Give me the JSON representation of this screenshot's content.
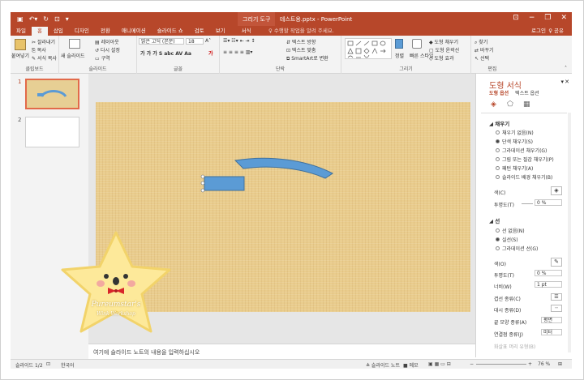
{
  "titlebar": {
    "context_tool": "그리기 도구",
    "doc_title": "테스트용.pptx - PowerPoint"
  },
  "tabs": [
    {
      "label": "파일"
    },
    {
      "label": "홈",
      "active": true
    },
    {
      "label": "삽입"
    },
    {
      "label": "디자인"
    },
    {
      "label": "전환"
    },
    {
      "label": "애니메이션"
    },
    {
      "label": "슬라이드 쇼"
    },
    {
      "label": "검토"
    },
    {
      "label": "보기"
    },
    {
      "label": "서식"
    }
  ],
  "tellme": "♀ 수행할 작업을 알려 주세요.",
  "login": "로그인",
  "share": "♀ 공유",
  "ribbon": {
    "clipboard": {
      "paste": "붙여넣기",
      "cut": "잘라내기",
      "copy": "복사",
      "format_painter": "서식 복사",
      "label": "클립보드"
    },
    "slides": {
      "new_slide": "새 슬라이드",
      "layout": "레이아웃",
      "reset": "다시 설정",
      "section": "구역",
      "label": "슬라이드"
    },
    "font": {
      "name": "맑은 고딕 (본문)",
      "size": "18",
      "label": "글꼴"
    },
    "paragraph": {
      "text_direction": "텍스트 방향",
      "align_text": "텍스트 맞춤",
      "smartart": "SmartArt로 변환",
      "label": "단락"
    },
    "drawing": {
      "arrange": "정렬",
      "quick_styles": "빠른 스타일",
      "fill": "도형 채우기",
      "outline": "도형 윤곽선",
      "effects": "도형 효과",
      "label": "그리기"
    },
    "editing": {
      "find": "찾기",
      "replace": "바꾸기",
      "select": "선택",
      "label": "편집"
    }
  },
  "slides_panel": [
    {
      "num": "1"
    },
    {
      "num": "2"
    }
  ],
  "notes_placeholder": "여기에 슬라이드 노트의 내용을 입력하십시오",
  "format_pane": {
    "title": "도형 서식",
    "tab_shape": "도형 옵션",
    "tab_text": "텍스트 옵션",
    "fill_header": "채우기",
    "fill_options": [
      "채우기 없음(N)",
      "단색 채우기(S)",
      "그라데이션 채우기(G)",
      "그림 또는 질감 채우기(P)",
      "패턴 채우기(A)",
      "슬라이드 배경 채우기(B)"
    ],
    "color_label": "색(C)",
    "transparency_label": "투명도(T)",
    "transparency_value": "0 %",
    "line_header": "선",
    "line_options": [
      "선 없음(N)",
      "실선(S)",
      "그라데이션 선(G)"
    ],
    "line_color_label": "색(O)",
    "line_transparency_label": "투명도(T)",
    "line_transparency_value": "0 %",
    "width_label": "너비(W)",
    "width_value": "1 pt",
    "compound_label": "겹선 종류(C)",
    "dash_label": "대시 종류(D)",
    "cap_label": "끝 모양 종류(A)",
    "cap_value": "평면",
    "join_label": "연결점 종류(J)",
    "join_value": "미터",
    "arrow_label": "화살표 머리 유형(B)"
  },
  "status": {
    "slide_info": "슬라이드 1/2",
    "language": "한국어",
    "notes": "≜ 슬라이드 노트",
    "comments": "■ 메모",
    "zoom": "76 %"
  },
  "watermark": {
    "line1": "Pureumstar's",
    "line2": "Wink Workshop"
  },
  "colors": {
    "accent": "#b7472a",
    "shape_fill": "#5b9bd5",
    "shape_border": "#41719c",
    "slide_bg": "#e9cc8c"
  }
}
